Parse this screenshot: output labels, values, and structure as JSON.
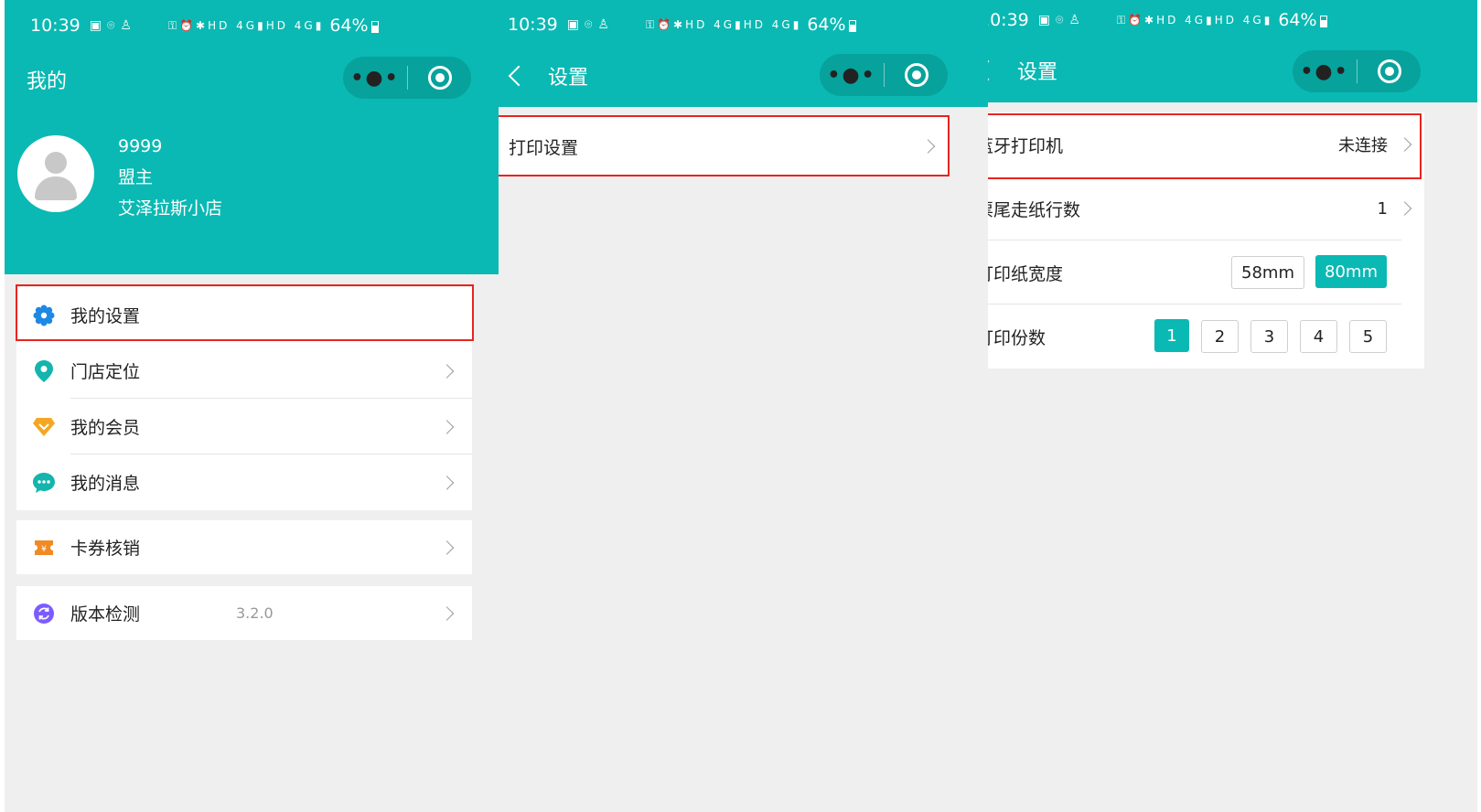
{
  "colors": {
    "primary": "#0ab9b3",
    "highlight": "#e8241f",
    "background": "#efefef"
  },
  "status_bar": {
    "time": "10:39",
    "battery": "64%",
    "network_left": "HD 4G",
    "network_right": "HD 4G"
  },
  "panel1": {
    "title": "我的",
    "profile": {
      "id": "9999",
      "role": "盟主",
      "store": "艾泽拉斯小店"
    },
    "menu": [
      {
        "label": "我的设置",
        "icon": "gear-icon",
        "icon_color": "#1e88e5"
      },
      {
        "label": "门店定位",
        "icon": "location-pin-icon",
        "icon_color": "#13b5ad"
      },
      {
        "label": "我的会员",
        "icon": "diamond-icon",
        "icon_color": "#f5a623"
      },
      {
        "label": "我的消息",
        "icon": "chat-bubble-icon",
        "icon_color": "#13b5ad"
      }
    ],
    "coupon": {
      "label": "卡券核销",
      "icon": "ticket-icon",
      "icon_color": "#f08a24"
    },
    "version": {
      "label": "版本检测",
      "value": "3.2.0",
      "icon": "refresh-icon",
      "icon_color": "#7b5cff"
    }
  },
  "panel2": {
    "title": "设置",
    "items": [
      {
        "label": "打印设置"
      }
    ]
  },
  "panel3": {
    "title": "设置",
    "bluetooth": {
      "label": "蓝牙打印机",
      "value": "未连接"
    },
    "feed_lines": {
      "label": "票尾走纸行数",
      "value": "1"
    },
    "paper_width": {
      "label": "打印纸宽度",
      "options": [
        "58mm",
        "80mm"
      ],
      "selected": "80mm"
    },
    "copies": {
      "label": "打印份数",
      "options": [
        "1",
        "2",
        "3",
        "4",
        "5"
      ],
      "selected": "1"
    }
  }
}
